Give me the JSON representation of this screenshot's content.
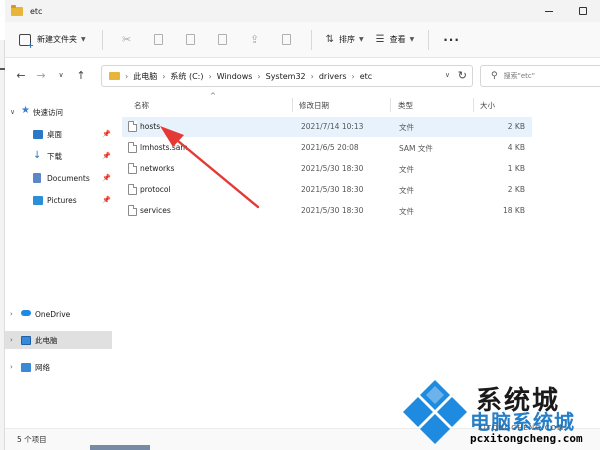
{
  "window": {
    "title": "etc"
  },
  "command_bar": {
    "new_label": "新建文件夹",
    "sort_label": "排序",
    "view_label": "查看",
    "more_label": "···"
  },
  "address": {
    "crumbs": [
      "此电脑",
      "系统 (C:)",
      "Windows",
      "System32",
      "drivers",
      "etc"
    ]
  },
  "search": {
    "placeholder": "搜索\"etc\""
  },
  "nav_pane": {
    "quick_access": "快速访问",
    "items": [
      {
        "label": "桌面",
        "icon": "desktop-icon",
        "color": "#2b77c8"
      },
      {
        "label": "下载",
        "icon": "download-icon",
        "color": "#2b77c8"
      },
      {
        "label": "Documents",
        "icon": "documents-icon",
        "color": "#5a87c8"
      },
      {
        "label": "Pictures",
        "icon": "pictures-icon",
        "color": "#2b8fd8"
      }
    ],
    "onedrive": "OneDrive",
    "this_pc": "此电脑",
    "network": "网络"
  },
  "columns": {
    "name": "名称",
    "modified": "修改日期",
    "type": "类型",
    "size": "大小"
  },
  "files": [
    {
      "name": "hosts",
      "modified": "2021/7/14 10:13",
      "type": "文件",
      "size": "2 KB"
    },
    {
      "name": "lmhosts.sam",
      "modified": "2021/6/5 20:08",
      "type": "SAM 文件",
      "size": "4 KB"
    },
    {
      "name": "networks",
      "modified": "2021/5/30 18:30",
      "type": "文件",
      "size": "1 KB"
    },
    {
      "name": "protocol",
      "modified": "2021/5/30 18:30",
      "type": "文件",
      "size": "2 KB"
    },
    {
      "name": "services",
      "modified": "2021/5/30 18:30",
      "type": "文件",
      "size": "18 KB"
    }
  ],
  "status": {
    "count": "5 个项目"
  },
  "watermark": {
    "title": "系统城",
    "subtitle": "电脑系统城",
    "middle": "XITONGCHENG.COM",
    "url": "pcxitongcheng.com"
  },
  "colors": {
    "accent": "#0a6ec0",
    "folder": "#e9b43a",
    "arrow": "#e53935"
  }
}
